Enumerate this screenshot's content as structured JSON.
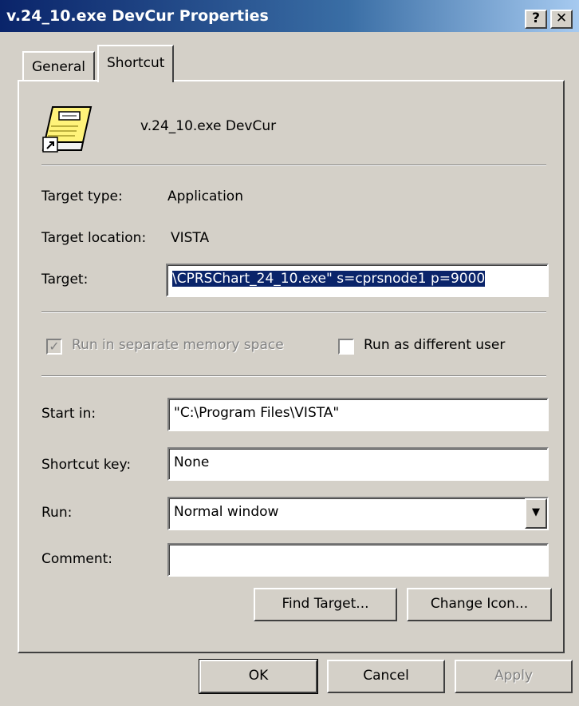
{
  "window": {
    "title": "v.24_10.exe DevCur Properties",
    "help_label": "?",
    "close_label": "✕"
  },
  "tabs": [
    {
      "label": "General",
      "active": false
    },
    {
      "label": "Shortcut",
      "active": true
    }
  ],
  "shortcut": {
    "name": "v.24_10.exe DevCur",
    "icon": "shortcut-icon",
    "target_type_label": "Target type:",
    "target_type_value": "Application",
    "target_location_label": "Target location:",
    "target_location_value": "VISTA",
    "target_label": "Target:",
    "target_value": "\\CPRSChart_24_10.exe\" s=cprsnode1 p=9000",
    "run_separate_label": "Run in separate memory space",
    "run_separate_checked": true,
    "run_separate_enabled": false,
    "run_different_user_label": "Run as different user",
    "run_different_user_checked": false,
    "start_in_label": "Start in:",
    "start_in_value": "\"C:\\Program Files\\VISTA\"",
    "shortcut_key_label": "Shortcut key:",
    "shortcut_key_value": "None",
    "run_label": "Run:",
    "run_value": "Normal window",
    "comment_label": "Comment:",
    "comment_value": "",
    "find_target_label": "Find Target...",
    "change_icon_label": "Change Icon..."
  },
  "footer": {
    "ok_label": "OK",
    "cancel_label": "Cancel",
    "apply_label": "Apply"
  },
  "colors": {
    "face": "#d4d0c8",
    "title_start": "#0a246a",
    "title_end": "#a6caf0",
    "selection": "#0a246a"
  }
}
